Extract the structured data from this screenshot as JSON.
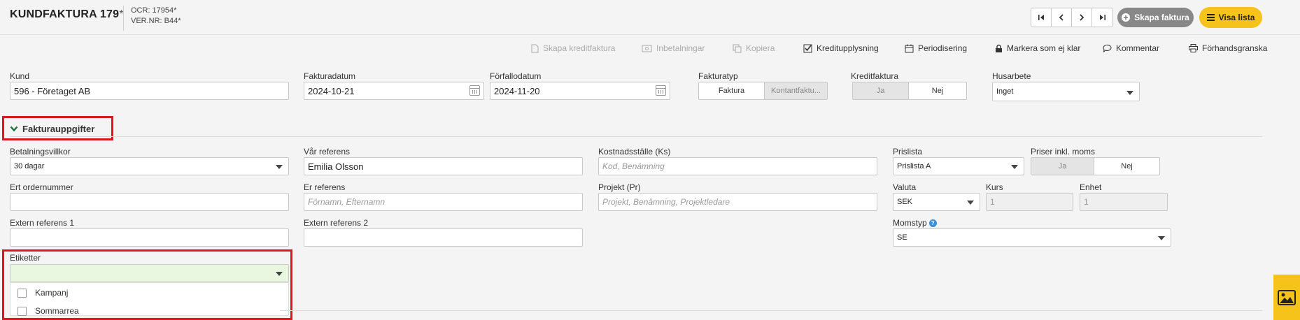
{
  "header": {
    "title": "KUNDFAKTURA 179",
    "title_suffix": "*",
    "ocr": "OCR: 17954*",
    "vernr": "VER.NR: B44*",
    "create_button": "Skapa faktura",
    "list_button": "Visa lista"
  },
  "toolbar": {
    "credit_invoice": "Skapa kreditfaktura",
    "payments": "Inbetalningar",
    "copy": "Kopiera",
    "credit_info": "Kreditupplysning",
    "accrual": "Periodisering",
    "mark_unready": "Markera som ej klar",
    "comment": "Kommentar",
    "preview": "Förhandsgranska"
  },
  "top_form": {
    "kund_label": "Kund",
    "kund_value": "596 - Företaget AB",
    "fakturadatum_label": "Fakturadatum",
    "fakturadatum_value": "2024-10-21",
    "forfallodatum_label": "Förfallodatum",
    "forfallodatum_value": "2024-11-20",
    "fakturatyp_label": "Fakturatyp",
    "fakturatyp_opt1": "Faktura",
    "fakturatyp_opt2": "Kontantfaktu...",
    "kreditfaktura_label": "Kreditfaktura",
    "kreditfaktura_ja": "Ja",
    "kreditfaktura_nej": "Nej",
    "husarbete_label": "Husarbete",
    "husarbete_value": "Inget"
  },
  "section": {
    "title": "Fakturauppgifter"
  },
  "details": {
    "betalningsvillkor_label": "Betalningsvillkor",
    "betalningsvillkor_value": "30 dagar",
    "var_referens_label": "Vår referens",
    "var_referens_value": "Emilia Olsson",
    "kostnadsstalle_label": "Kostnadsställe (Ks)",
    "kostnadsstalle_placeholder": "Kod, Benämning",
    "prislista_label": "Prislista",
    "prislista_value": "Prislista A",
    "priser_inkl_moms_label": "Priser inkl. moms",
    "priser_ja": "Ja",
    "priser_nej": "Nej",
    "ert_ordernummer_label": "Ert ordernummer",
    "er_referens_label": "Er referens",
    "er_referens_placeholder": "Förnamn, Efternamn",
    "projekt_label": "Projekt (Pr)",
    "projekt_placeholder": "Projekt, Benämning, Projektledare",
    "valuta_label": "Valuta",
    "valuta_value": "SEK",
    "kurs_label": "Kurs",
    "kurs_value": "1",
    "enhet_label": "Enhet",
    "enhet_value": "1",
    "extern_ref1_label": "Extern referens 1",
    "extern_ref2_label": "Extern referens 2",
    "momstyp_label": "Momstyp",
    "momstyp_value": "SE",
    "etiketter_label": "Etiketter",
    "etiketter_options": [
      "Kampanj",
      "Sommarrea"
    ]
  },
  "colors": {
    "accent_yellow": "#f6c31a",
    "highlight_red": "#e0161e",
    "select_green": "#e9f7e0"
  }
}
